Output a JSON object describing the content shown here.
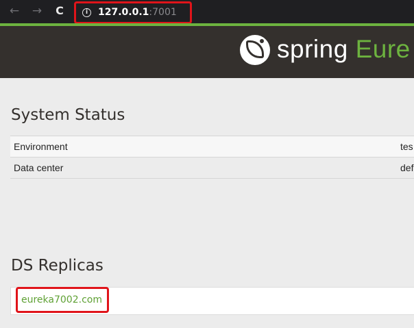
{
  "browser": {
    "back_icon": "←",
    "forward_icon": "→",
    "reload_icon": "C",
    "url_host": "127.0.0.1",
    "url_port": ":7001"
  },
  "header": {
    "brand_spring": "spring",
    "brand_eureka": "Eure"
  },
  "system_status": {
    "title": "System Status",
    "rows": [
      {
        "label": "Environment",
        "value": "tes"
      },
      {
        "label": "Data center",
        "value": "def"
      }
    ]
  },
  "ds_replicas": {
    "title": "DS Replicas",
    "items": [
      "eureka7002.com"
    ]
  },
  "colors": {
    "accent": "#6db33f",
    "header_bg": "#34302d",
    "highlight": "#e0141a"
  }
}
